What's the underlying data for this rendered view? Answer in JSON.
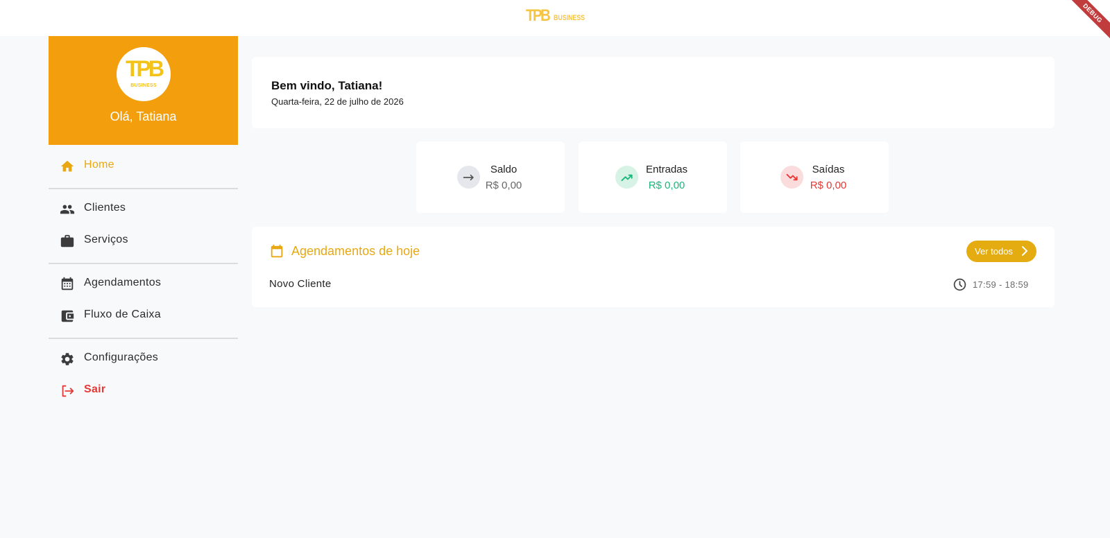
{
  "header": {
    "logo_mono": "TPB",
    "logo_word": "BUSINESS",
    "debug_label": "DEBUG"
  },
  "sidebar": {
    "avatar_mono": "TPB",
    "avatar_word": "BUSINESS",
    "greeting": "Olá, Tatiana",
    "items": [
      {
        "label": "Home",
        "icon": "home-icon"
      },
      {
        "label": "Clientes",
        "icon": "people-icon"
      },
      {
        "label": "Serviços",
        "icon": "briefcase-icon"
      },
      {
        "label": "Agendamentos",
        "icon": "calendar-icon"
      },
      {
        "label": "Fluxo de Caixa",
        "icon": "wallet-icon"
      },
      {
        "label": "Configurações",
        "icon": "gear-icon"
      },
      {
        "label": "Sair",
        "icon": "logout-icon"
      }
    ]
  },
  "welcome": {
    "title": "Bem vindo, Tatiana!",
    "date": "Quarta-feira, 22 de julho de 2026"
  },
  "stats": [
    {
      "name": "Saldo",
      "value": "R$ 0,00",
      "color": "#666666",
      "icon": "arrow-right-icon"
    },
    {
      "name": "Entradas",
      "value": "R$ 0,00",
      "color": "#1db57a",
      "icon": "trending-up-icon"
    },
    {
      "name": "Saídas",
      "value": "R$ 0,00",
      "color": "#e53935",
      "icon": "trending-down-icon"
    }
  ],
  "appointments": {
    "title": "Agendamentos de hoje",
    "view_all": "Ver todos",
    "items": [
      {
        "client": "Novo Cliente",
        "time": "17:59 - 18:59"
      }
    ]
  },
  "colors": {
    "accent": "#e9a811",
    "profile_bg": "#f39f0d",
    "danger": "#e53935",
    "success": "#1db57a"
  }
}
